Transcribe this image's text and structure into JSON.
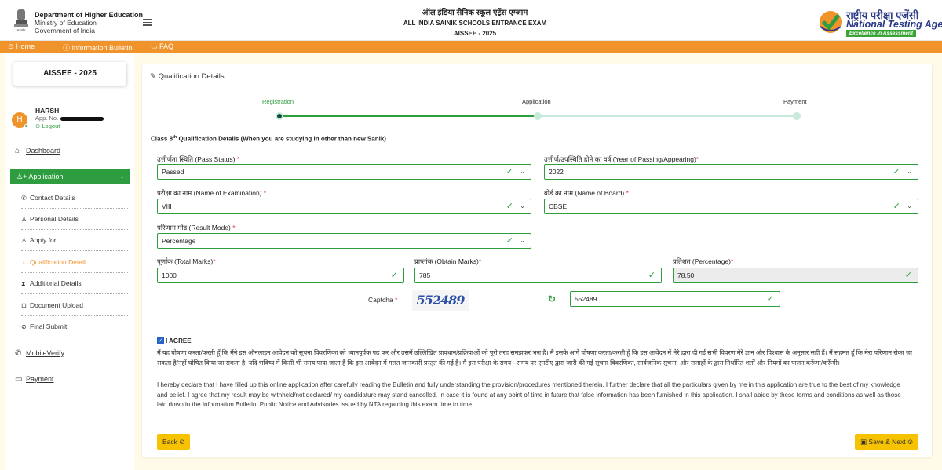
{
  "header": {
    "dept_line1": "Department of Higher Education",
    "dept_line2": "Ministry of Education",
    "dept_line3": "Government of India",
    "title_hi": "ऑल इंडिया सैनिक स्कूल एंट्रेंस एग्जाम",
    "title_en": "ALL INDIA SAINIK SCHOOLS ENTRANCE EXAM",
    "exam": "AISSEE - 2025",
    "nta_hi": "राष्ट्रीय परीक्षा एजेंसी",
    "nta_en": "National Testing Agency",
    "nta_tagline": "Excellence in Assessment"
  },
  "nav": {
    "home": "Home",
    "bulletin": "Information Bulletin",
    "faq": "FAQ"
  },
  "sidebar": {
    "exam_box": "AISSEE - 2025",
    "avatar_letter": "H",
    "user_name": "HARSH",
    "app_no_label": "App. No.",
    "logout": "Logout",
    "dashboard": "Dashboard",
    "application": "Application",
    "sub_items": [
      "Contact Details",
      "Personal Details",
      "Apply for",
      "Qualification Detail",
      "Additional Details",
      "Document Upload",
      "Final Submit"
    ],
    "mobile_verify": "MobileVerify",
    "payment": "Payment"
  },
  "card": {
    "title": "Qualification Details",
    "steps": [
      "Registration",
      "Application",
      "Payment"
    ],
    "section_title_pre": "Class 8",
    "section_title_sup": "th",
    "section_title_post": " Qualification Details (When you are studying in other than new Sanik)"
  },
  "fields": {
    "pass_status": {
      "label": "उत्तीर्णता स्थिति (Pass Status)",
      "value": "Passed"
    },
    "year": {
      "label": "उत्तीर्ण/उपस्थिति होने का वर्ष (Year of Passing/Appearing)",
      "value": "2022"
    },
    "exam_name": {
      "label": "परीक्षा का नाम (Name of Examination)",
      "value": "VIII"
    },
    "board": {
      "label": "बोर्ड का नाम (Name of Board)",
      "value": "CBSE"
    },
    "result_mode": {
      "label": "परिणाम मोड (Result Mode)",
      "value": "Percentage"
    },
    "total_marks": {
      "label": "पूर्णांक (Total Marks)",
      "value": "1000"
    },
    "obtain_marks": {
      "label": "प्राप्तांक (Obtain Marks)",
      "value": "785"
    },
    "percentage": {
      "label": "प्रतिशत (Percentage)",
      "value": "78.50"
    },
    "captcha_label": "Captcha",
    "captcha_text": "552489",
    "captcha_value": "552489"
  },
  "agree": {
    "label": "I AGREE",
    "hindi": "मैं यह घोषणा करता/करती हूँ कि मैंने इस ऑनलाइन आवेदन को सूचना विवरणिका को ध्यानपूर्वक पढ़ कर और उसमें उल्लिखित प्रावधान/प्रक्रियाओं को पूरी तरह समझकर भरा है। मैं इसके आगे घोषणा करता/करती हूँ कि इस आवेदन में मेरे द्वारा दी गई सभी विवरण मेरे ज्ञान और विश्वास के अनुसार सही हैं। मैं सहमत हूँ कि मेरा परिणाम रोका जा सकता है/नहीं घोषित किया जा सकता है, यदि भविष्य में किसी भी समय पाया जाता है कि इस आवेदन में गलत जानकारी प्रस्तुत की गई है। मैं इस परीक्षा के समय - समय पर एनटीए द्वारा जारी की गई सूचना विवरणिका, सार्वजनिक सूचना, और सलाहों के द्वारा निर्धारित शर्तों और नियमों का पालन करूँगा/करूँगी।",
    "english": "I hereby declare that I have filled up this online application after carefully reading the Bulletin and fully understanding the provision/procedures mentioned therein. I further declare that all the particulars given by me in this application are true to the best of my knowledge and belief. I agree that my result may be withheld/not declared/ my candidature may stand cancelled. In case it is found at any point of time in future that false information has been furnished in this application. I shall abide by these terms and conditions as well as those laid down in the Information Bulletin, Public Notice and Advisories issued by NTA regarding this exam time to time."
  },
  "buttons": {
    "back": "Back",
    "save_next": "Save & Next"
  },
  "colors": {
    "brand_orange": "#f0932b",
    "brand_green": "#2e9d3f",
    "button_yellow": "#f7c200",
    "nta_blue": "#2a3a86"
  }
}
